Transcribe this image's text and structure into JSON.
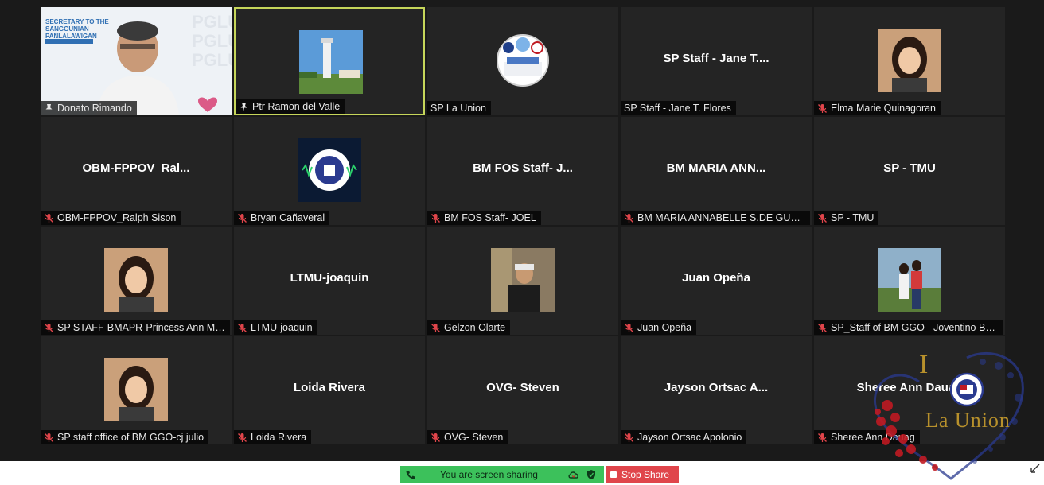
{
  "tiles": [
    {
      "name": "Donato Rimando",
      "center": "",
      "caption_icon": "pin-icon",
      "photo": "presenter-video",
      "active": false
    },
    {
      "name": "Ptr Ramon del Valle",
      "center": "",
      "caption_icon": "pin-icon",
      "photo": "tower-photo",
      "active": true
    },
    {
      "name": "SP La Union",
      "center": "",
      "caption_icon": "none",
      "photo": "sp-logo",
      "active": false
    },
    {
      "name": "SP Staff - Jane T. Flores",
      "center": "SP Staff - Jane T....",
      "caption_icon": "none",
      "photo": "none",
      "active": false
    },
    {
      "name": "Elma Marie Quinagoran",
      "center": "",
      "caption_icon": "muted-mic-icon",
      "photo": "woman-photo",
      "active": false
    },
    {
      "name": "OBM-FPPOV_Ralph Sison",
      "center": "OBM-FPPOV_Ral...",
      "caption_icon": "muted-mic-icon",
      "photo": "none",
      "active": false
    },
    {
      "name": "Bryan Cañaveral",
      "center": "",
      "caption_icon": "muted-mic-icon",
      "photo": "radio-logo",
      "active": false
    },
    {
      "name": "BM FOS Staff- JOEL",
      "center": "BM FOS Staff- J...",
      "caption_icon": "muted-mic-icon",
      "photo": "none",
      "active": false
    },
    {
      "name": "BM MARIA ANNABELLE S.DE GUZM...",
      "center": "BM MARIA ANN...",
      "caption_icon": "muted-mic-icon",
      "photo": "none",
      "active": false
    },
    {
      "name": "SP - TMU",
      "center": "SP - TMU",
      "caption_icon": "muted-mic-icon",
      "photo": "none",
      "active": false
    },
    {
      "name": "SP STAFF-BMAPR-Princess Ann Ma...",
      "center": "",
      "caption_icon": "muted-mic-icon",
      "photo": "woman-photo",
      "active": false
    },
    {
      "name": "LTMU-joaquin",
      "center": "LTMU-joaquin",
      "caption_icon": "muted-mic-icon",
      "photo": "none",
      "active": false
    },
    {
      "name": "Gelzon Olarte",
      "center": "",
      "caption_icon": "muted-mic-icon",
      "photo": "man-photo",
      "active": false
    },
    {
      "name": "Juan Opeña",
      "center": "Juan Opeña",
      "caption_icon": "muted-mic-icon",
      "photo": "none",
      "active": false
    },
    {
      "name": "SP_Staff of BM GGO - Joventino Ba...",
      "center": "",
      "caption_icon": "muted-mic-icon",
      "photo": "couple-photo",
      "active": false
    },
    {
      "name": "SP staff office of BM GGO-cj julio",
      "center": "",
      "caption_icon": "muted-mic-icon",
      "photo": "woman-photo",
      "active": false
    },
    {
      "name": "Loida Rivera",
      "center": "Loida Rivera",
      "caption_icon": "muted-mic-icon",
      "photo": "none",
      "active": false
    },
    {
      "name": "OVG- Steven",
      "center": "OVG- Steven",
      "caption_icon": "muted-mic-icon",
      "photo": "none",
      "active": false
    },
    {
      "name": "Jayson Ortsac Apolonio",
      "center": "Jayson Ortsac A...",
      "caption_icon": "muted-mic-icon",
      "photo": "none",
      "active": false
    },
    {
      "name": "Sheree Ann Dauag",
      "center": "Sheree Ann Dauag",
      "caption_icon": "muted-mic-icon",
      "photo": "none",
      "active": false
    }
  ],
  "share_bar": {
    "status": "You are screen sharing",
    "stop_label": "Stop Share"
  },
  "watermark": {
    "letter": "I",
    "text": "La Union"
  },
  "presenter_slide": {
    "line1": "SECRETARY TO THE",
    "line2": "SANGGUNIAN",
    "line3": "PANLALAWIGAN"
  },
  "colors": {
    "active_border": "#c6d65a",
    "muted_icon": "#e0454b",
    "share_green": "#3cc15b",
    "stop_red": "#e0454b"
  }
}
